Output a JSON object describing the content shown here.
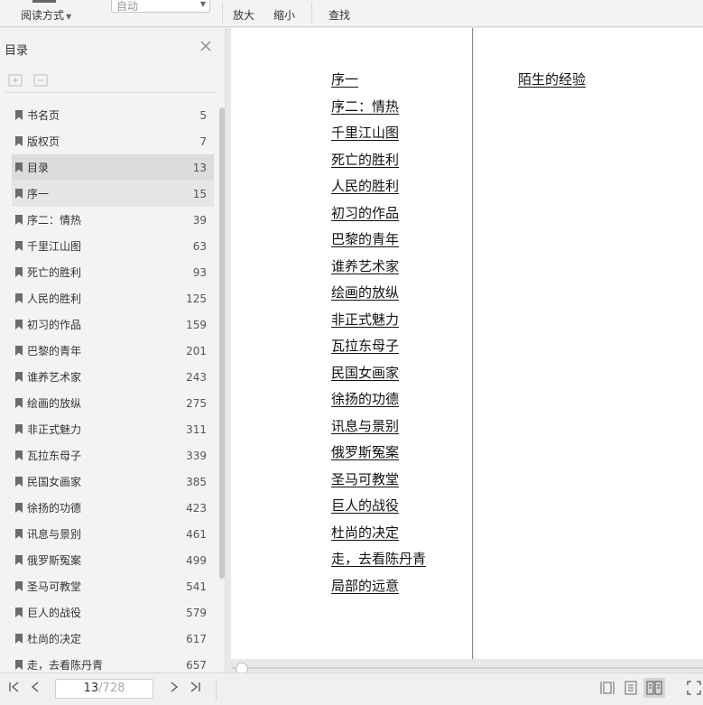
{
  "toolbar": {
    "read_mode_label": "阅读方式",
    "zoom_select_value": "自动",
    "zoom_in_label": "放大",
    "zoom_out_label": "缩小",
    "find_label": "查找"
  },
  "sidebar": {
    "title": "目录",
    "items": [
      {
        "label": "书名页",
        "page": "5"
      },
      {
        "label": "版权页",
        "page": "7"
      },
      {
        "label": "目录",
        "page": "13"
      },
      {
        "label": "序一",
        "page": "15"
      },
      {
        "label": "序二：情热",
        "page": "39"
      },
      {
        "label": "千里江山图",
        "page": "63"
      },
      {
        "label": "死亡的胜利",
        "page": "93"
      },
      {
        "label": "人民的胜利",
        "page": "125"
      },
      {
        "label": "初习的作品",
        "page": "159"
      },
      {
        "label": "巴黎的青年",
        "page": "201"
      },
      {
        "label": "谁养艺术家",
        "page": "243"
      },
      {
        "label": "绘画的放纵",
        "page": "275"
      },
      {
        "label": "非正式魅力",
        "page": "311"
      },
      {
        "label": "瓦拉东母子",
        "page": "339"
      },
      {
        "label": "民国女画家",
        "page": "385"
      },
      {
        "label": "徐扬的功德",
        "page": "423"
      },
      {
        "label": "讯息与景别",
        "page": "461"
      },
      {
        "label": "俄罗斯冤案",
        "page": "499"
      },
      {
        "label": "圣马可教堂",
        "page": "541"
      },
      {
        "label": "巨人的战役",
        "page": "579"
      },
      {
        "label": "杜尚的决定",
        "page": "617"
      },
      {
        "label": "走，去看陈丹青",
        "page": "657"
      }
    ]
  },
  "page": {
    "left_toc": [
      "序一",
      "序二：情热",
      "千里江山图",
      "死亡的胜利",
      "人民的胜利",
      "初习的作品",
      "巴黎的青年",
      "谁养艺术家",
      "绘画的放纵",
      "非正式魅力",
      "瓦拉东母子",
      "民国女画家",
      "徐扬的功德",
      "讯息与景别",
      "俄罗斯冤案",
      "圣马可教堂",
      "巨人的战役",
      "杜尚的决定",
      "走，去看陈丹青",
      "局部的远意"
    ],
    "right_toc": [
      "陌生的经验"
    ]
  },
  "bottombar": {
    "current_page": "13",
    "total_pages": "/728"
  }
}
